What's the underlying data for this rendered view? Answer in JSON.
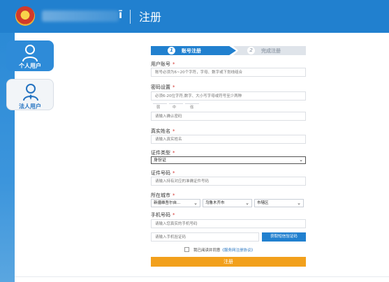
{
  "header": {
    "title": "注册",
    "logo_mark": "ī"
  },
  "sidebar": {
    "personal_label": "个人用户",
    "legal_label": "法人用户"
  },
  "steps": [
    {
      "num": "1",
      "label": "账号注册"
    },
    {
      "num": "2",
      "label": "完成注册"
    }
  ],
  "form": {
    "account": {
      "label": "用户账号",
      "required": "*",
      "placeholder": "账号必须为6~20个字符，字母、数字或下划线组合"
    },
    "password": {
      "label": "密码设置",
      "required": "*",
      "placeholder": "必须6-20位字符,数字、大小写字母或符号至少两种"
    },
    "strength": [
      "弱",
      "中",
      "强"
    ],
    "confirm_password": {
      "placeholder": "请输入确认密码"
    },
    "real_name": {
      "label": "真实姓名",
      "required": "*",
      "placeholder": "请输入真实姓名"
    },
    "id_type": {
      "label": "证件类型",
      "required": "*",
      "value": "身份证"
    },
    "id_number": {
      "label": "证件号码",
      "required": "*",
      "placeholder": "请输入持有对应的准确证件号码"
    },
    "city": {
      "label": "所在城市",
      "required": "*",
      "province": "新疆维吾尔自...",
      "city": "乌鲁木齐市",
      "district": "市辖区"
    },
    "phone": {
      "label": "手机号码",
      "required": "*",
      "placeholder": "请输入您真实的手机号码"
    },
    "sms_code": {
      "placeholder": "请输入手机验证码",
      "button": "获取短信验证码"
    },
    "agree": {
      "prefix": "我已阅读并同意",
      "link": "《服务网注册协议》"
    },
    "submit": "注册"
  }
}
